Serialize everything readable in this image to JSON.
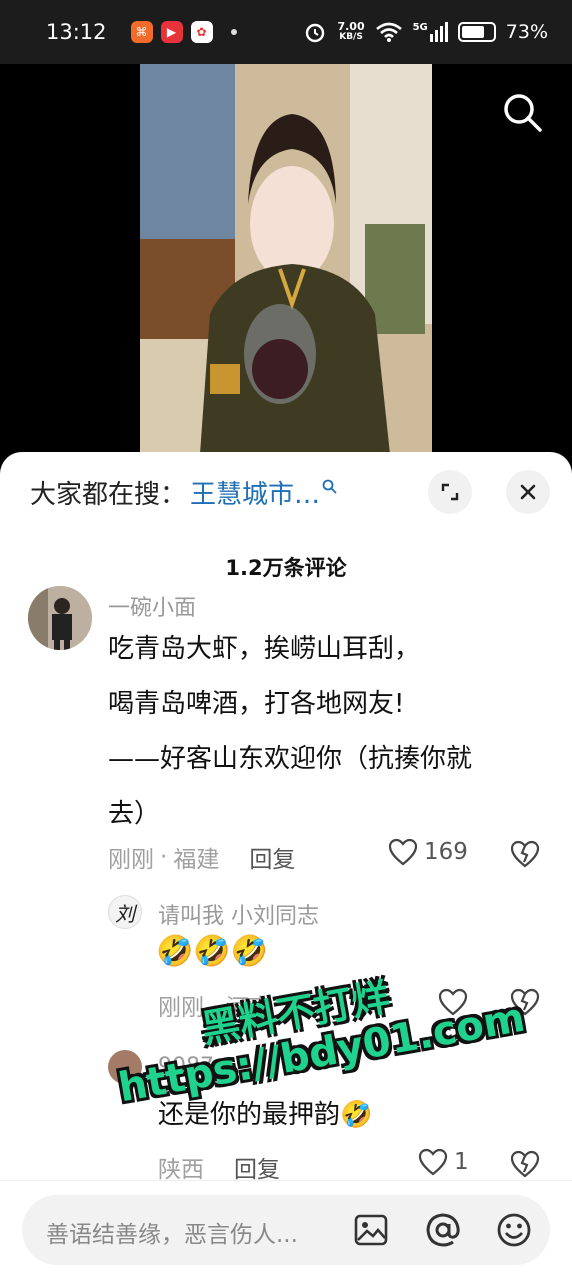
{
  "status_bar": {
    "time": "13:12",
    "net_speed_value": "7.00",
    "net_speed_unit": "KB/S",
    "signal_label": "5G",
    "battery": "73%",
    "battery_level": 0.73
  },
  "hot_search": {
    "prefix": "大家都在搜：",
    "term": "王慧城市…"
  },
  "comments_header": {
    "count_label": "1.2万条评论"
  },
  "comments": [
    {
      "username": "一碗小面",
      "lines": [
        "吃青岛大虾，挨崂山耳刮，",
        "喝青岛啤酒，打各地网友!",
        "——好客山东欢迎你（抗揍你就",
        "去）"
      ],
      "time": "刚刚",
      "location": "福建",
      "reply_label": "回复",
      "likes": "169"
    }
  ],
  "replies": [
    {
      "username": "请叫我  小刘同志",
      "avatar_text": "刘",
      "content": "🤣🤣🤣",
      "meta": "刚刚 · 河南",
      "likes": ""
    },
    {
      "username": "9087",
      "content": "还是你的最押韵🤣",
      "location": "陕西",
      "reply_label": "回复",
      "likes": "1"
    }
  ],
  "watermark": {
    "line1": "黑料不打烊",
    "line2": "https://bdy01.com"
  },
  "input_bar": {
    "placeholder": "善语结善缘，恶言伤人..."
  }
}
